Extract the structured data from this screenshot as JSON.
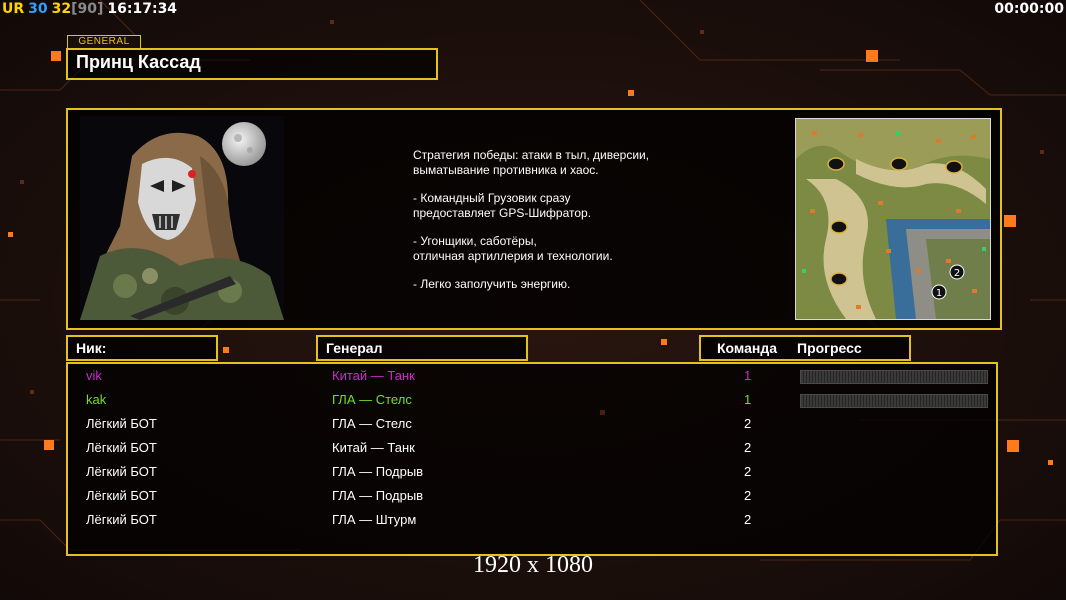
{
  "hud": {
    "ur_label": "UR",
    "fps1": "30",
    "fps2": "32",
    "fps_max": "[90]",
    "clock": "16:17:34",
    "timer": "00:00:00",
    "colors": {
      "ur": "#ffd400",
      "fps1": "#2ea0ff",
      "fps2": "#ffd400",
      "fps_max": "#8a8a8a"
    }
  },
  "general": {
    "section_label": "GENERAL",
    "name": "Принц Кассад",
    "portrait_icon": "predator-masked-soldier-portrait",
    "description": [
      "Стратегия победы: атаки в тыл, диверсии,\n выматывание противника и хаос.",
      "- Командный Грузовик сразу\nпредоставляет GPS-Шифратор.",
      "- Угонщики, саботёры,\nотличная артиллерия и технологии.",
      "- Легко заполучить энергию."
    ],
    "minimap_icon": "map-preview",
    "minimap_markers": [
      "1",
      "2"
    ]
  },
  "table": {
    "headers": {
      "nick": "Ник:",
      "general": "Генерал",
      "team": "Команда",
      "progress": "Прогресс"
    },
    "players": [
      {
        "nick": "vik",
        "general": "Китай — Танк",
        "team": "1",
        "color": "#c82ec8",
        "has_progress": true
      },
      {
        "nick": "kak",
        "general": "ГЛА — Стелс",
        "team": "1",
        "color": "#6fe02a",
        "has_progress": true
      },
      {
        "nick": "Лёгкий БОТ",
        "general": "ГЛА — Стелс",
        "team": "2",
        "color": "#ffffff",
        "has_progress": false
      },
      {
        "nick": "Лёгкий БОТ",
        "general": "Китай — Танк",
        "team": "2",
        "color": "#ffffff",
        "has_progress": false
      },
      {
        "nick": "Лёгкий БОТ",
        "general": "ГЛА — Подрыв",
        "team": "2",
        "color": "#ffffff",
        "has_progress": false
      },
      {
        "nick": "Лёгкий БОТ",
        "general": "ГЛА — Подрыв",
        "team": "2",
        "color": "#ffffff",
        "has_progress": false
      },
      {
        "nick": "Лёгкий БОТ",
        "general": "ГЛА — Штурм",
        "team": "2",
        "color": "#ffffff",
        "has_progress": false
      }
    ]
  },
  "resolution": "1920 x 1080",
  "colors": {
    "accent": "#e3c21f",
    "background": "#1a0f0b",
    "glow": "#ff7a1a"
  }
}
